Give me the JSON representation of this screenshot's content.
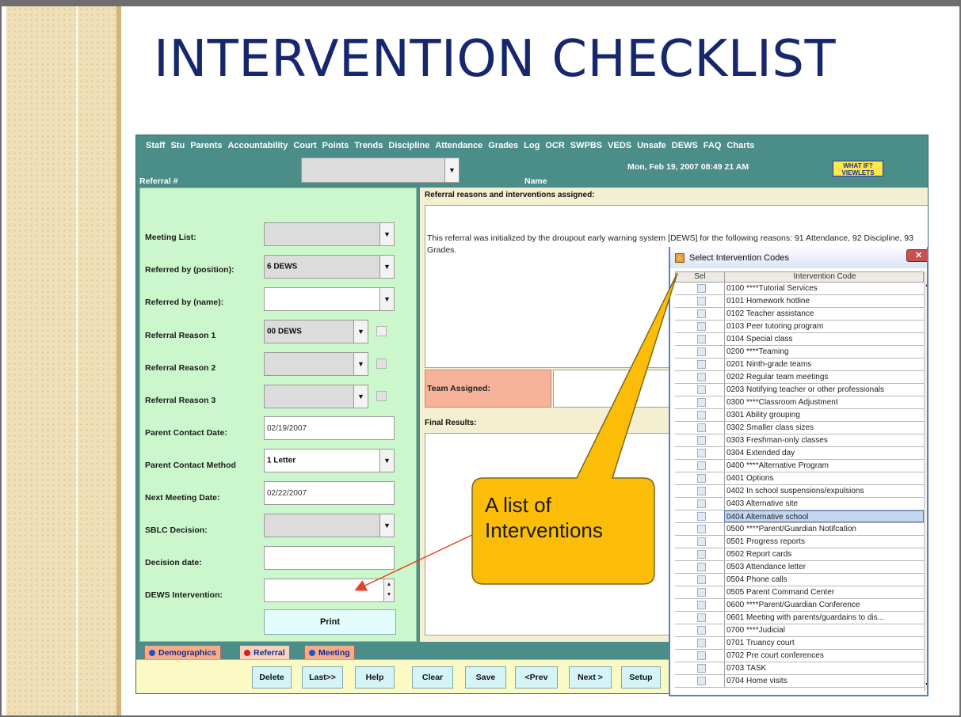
{
  "slide": {
    "title": "INTERVENTION CHECKLIST",
    "callout": {
      "line1": "A list of",
      "line2": "Interventions"
    }
  },
  "menu": [
    "Staff",
    "Stu",
    "Parents",
    "Accountability",
    "Court",
    "Points",
    "Trends",
    "Discipline",
    "Attendance",
    "Grades",
    "Log",
    "OCR",
    "SWPBS",
    "VEDS",
    "Unsafe",
    "DEWS",
    "FAQ",
    "Charts"
  ],
  "header": {
    "referral_label": "Referral #",
    "name_label": "Name",
    "datetime": "Mon, Feb 19, 2007  08:49 21 AM",
    "viewlets_line1": "WHAT IF?",
    "viewlets_line2": "VIEWLETS"
  },
  "form": {
    "meeting_list_label": "Meeting List:",
    "meeting_list_value": "",
    "referred_by_position_label": "Referred by (position):",
    "referred_by_position_value": "6 DEWS",
    "referred_by_name_label": "Referred by (name):",
    "referred_by_name_value": "",
    "reason1_label": "Referral Reason 1",
    "reason1_value": "00 DEWS",
    "reason2_label": "Referral Reason 2",
    "reason3_label": "Referral Reason 3",
    "parent_contact_date_label": "Parent Contact Date:",
    "parent_contact_date_value": "02/19/2007",
    "parent_contact_method_label": "Parent Contact Method",
    "parent_contact_method_value": "1 Letter",
    "next_meeting_date_label": "Next Meeting Date:",
    "next_meeting_date_value": "02/22/2007",
    "sblc_decision_label": "SBLC Decision:",
    "decision_date_label": "Decision date:",
    "dews_intervention_label": "DEWS Intervention:",
    "print_label": "Print"
  },
  "right": {
    "reasons_title": "Referral reasons and interventions assigned:",
    "reasons_text": "This referral was initialized by the droupout early warning system [DEWS] for the following reasons: 91 Attendance, 92 Discipline, 93 Grades.",
    "team_assigned_label": "Team Assigned:",
    "final_results_label": "Final Results:"
  },
  "tabs": [
    {
      "label": "Demographics",
      "dot_color": "#2a4fc9"
    },
    {
      "label": "Referral",
      "dot_color": "#d92020"
    },
    {
      "label": "Meeting",
      "dot_color": "#2a4fc9"
    }
  ],
  "buttons": [
    "Delete",
    "Last>>",
    "Help",
    "Clear",
    "Save",
    "<Prev",
    "Next >",
    "Setup"
  ],
  "dialog": {
    "title": "Select Intervention Codes",
    "col_sel": "Sel",
    "col_code": "Intervention Code",
    "selected_code": "0404 Alternative school",
    "rows": [
      "0100 ****Tutorial Services",
      "0101 Homework hotline",
      "0102 Teacher assistance",
      "0103 Peer tutoring program",
      "0104 Special class",
      "0200 ****Teaming",
      "0201 Ninth-grade teams",
      "0202 Regular team meetings",
      "0203 Notifying teacher or other professionals",
      "0300 ****Classroom Adjustment",
      "0301 Ability grouping",
      "0302 Smaller class sizes",
      "0303 Freshman-only classes",
      "0304 Extended day",
      "0400 ****Alternative Program",
      "0401 Options",
      "0402 In school suspensions/expulsions",
      "0403 Alternative site",
      "0404 Alternative school",
      "0500 ****Parent/Guardian Notifcation",
      "0501 Progress reports",
      "0502 Report cards",
      "0503 Attendance letter",
      "0504 Phone calls",
      "0505 Parent Command Center",
      "0600 ****Parent/Guardian Conference",
      "0601 Meeting with parents/guardains to dis...",
      "0700 ****Judicial",
      "0701 Truancy court",
      "0702 Pre court conferences",
      "0703 TASK",
      "0704 Home visits"
    ]
  }
}
